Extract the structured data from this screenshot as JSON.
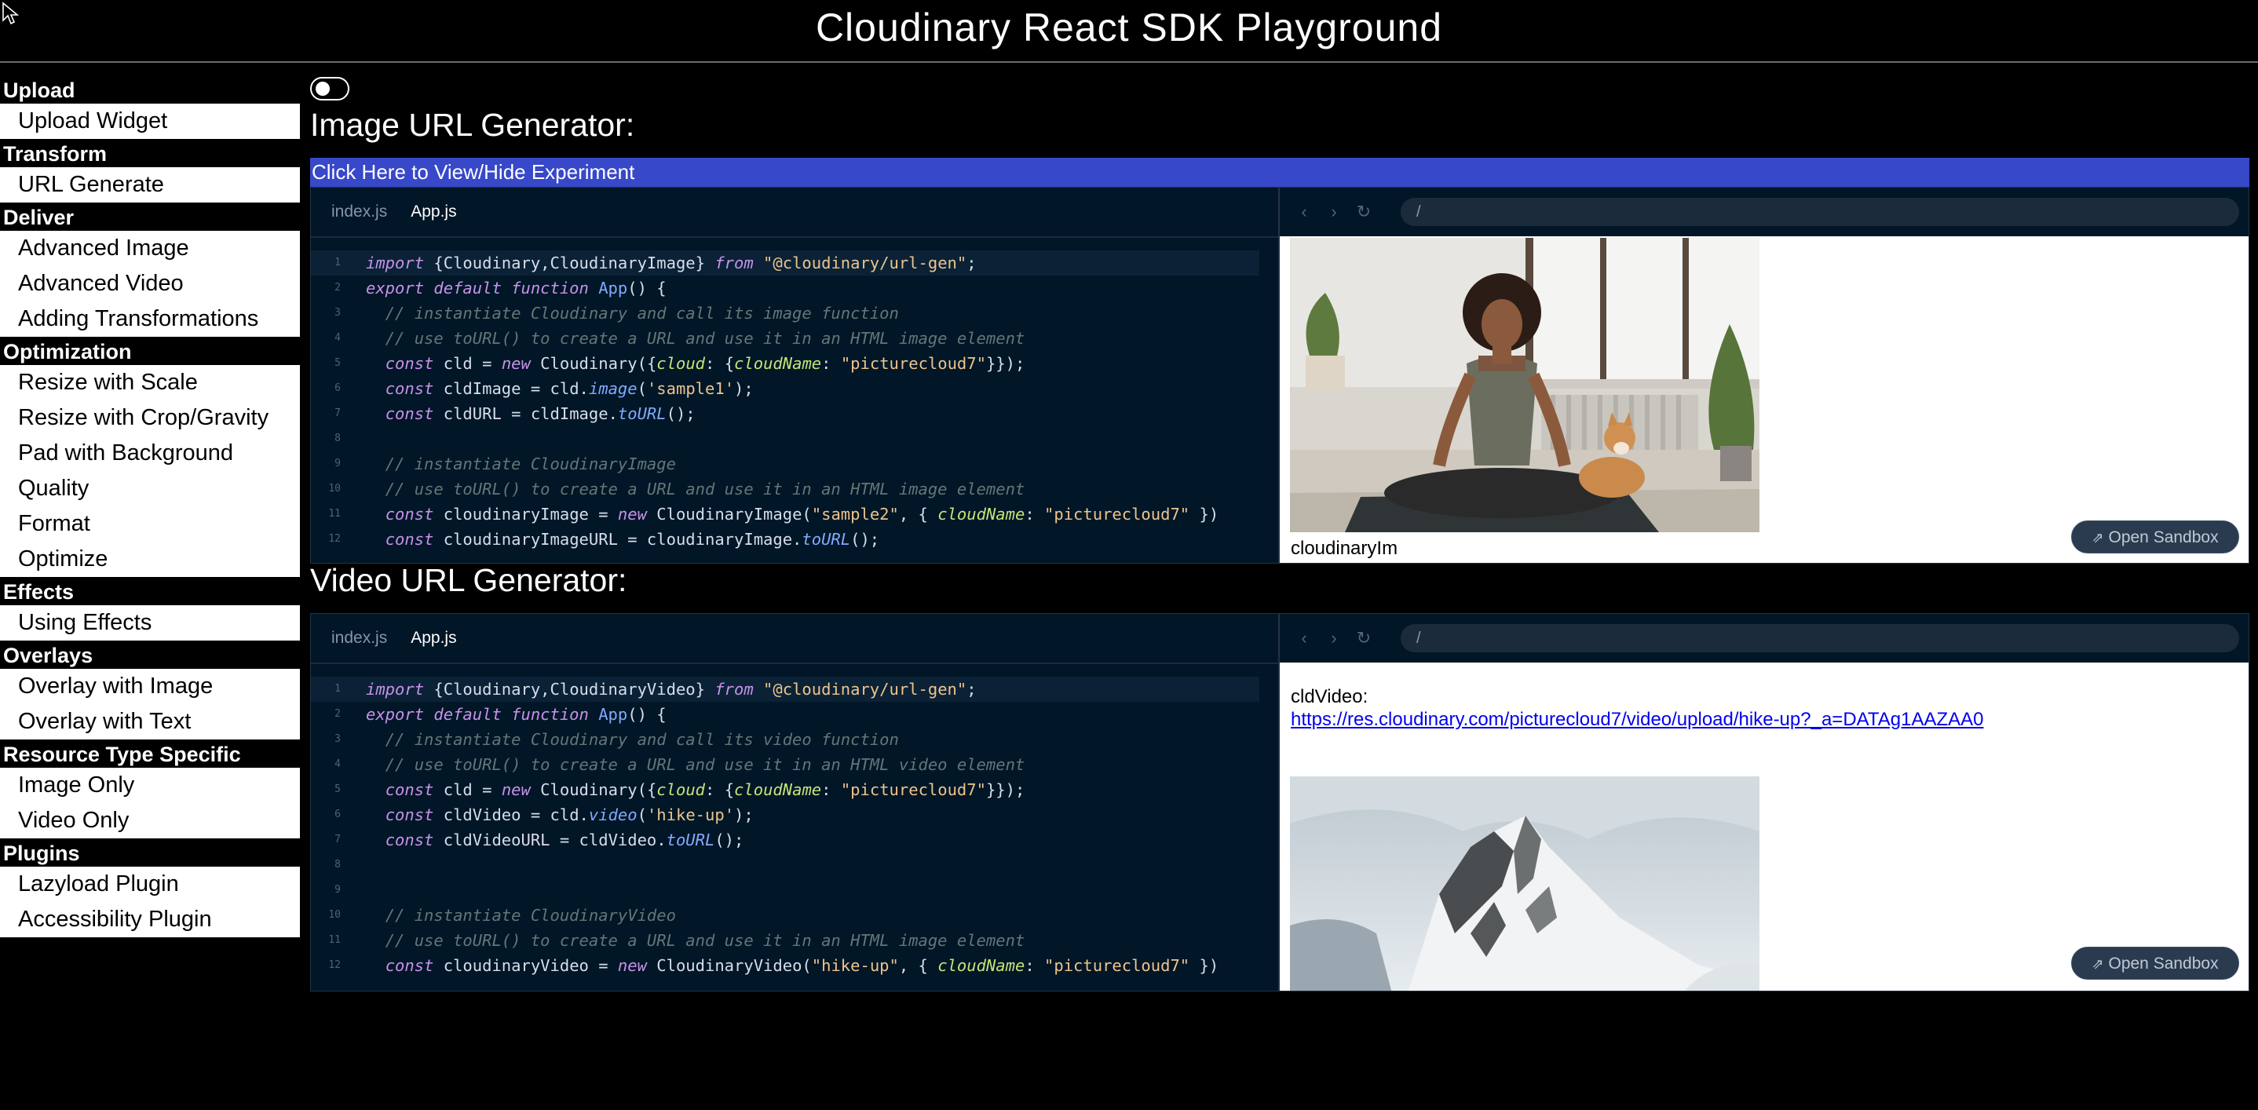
{
  "app": {
    "title": "Cloudinary React SDK Playground"
  },
  "sidebar": {
    "sections": [
      {
        "label": "Upload",
        "items": [
          "Upload Widget"
        ]
      },
      {
        "label": "Transform",
        "items": [
          "URL Generate"
        ]
      },
      {
        "label": "Deliver",
        "items": [
          "Advanced Image",
          "Advanced Video",
          "Adding Transformations"
        ]
      },
      {
        "label": "Optimization",
        "items": [
          "Resize with Scale",
          "Resize with Crop/Gravity",
          "Pad with Background",
          "Quality",
          "Format",
          "Optimize"
        ]
      },
      {
        "label": "Effects",
        "items": [
          "Using Effects"
        ]
      },
      {
        "label": "Overlays",
        "items": [
          "Overlay with Image",
          "Overlay with Text"
        ]
      },
      {
        "label": "Resource Type Specific",
        "items": [
          "Image Only",
          "Video Only"
        ]
      },
      {
        "label": "Plugins",
        "items": [
          "Lazyload Plugin",
          "Accessibility Plugin"
        ]
      }
    ]
  },
  "main": {
    "toggle_state": "off",
    "image_section": {
      "heading": "Image URL Generator:",
      "toggle_label": "Click Here to View/Hide Experiment",
      "tabs": [
        "index.js",
        "App.js"
      ],
      "active_tab": "App.js",
      "url": "/",
      "open_sandbox": "Open Sandbox",
      "line_numbers": [
        "1",
        "2",
        "3",
        "4",
        "5",
        "6",
        "7",
        "8",
        "9",
        "10",
        "11",
        "12"
      ],
      "preview_caption_partial": "cloudinaryIm"
    },
    "video_section": {
      "heading": "Video URL Generator:",
      "tabs": [
        "index.js",
        "App.js"
      ],
      "active_tab": "App.js",
      "url": "/",
      "open_sandbox": "Open Sandbox",
      "line_numbers": [
        "1",
        "2",
        "3",
        "4",
        "5",
        "6",
        "7",
        "8",
        "9",
        "10",
        "11",
        "12"
      ],
      "preview_label": "cldVideo:",
      "preview_link": "https://res.cloudinary.com/picturecloud7/video/upload/hike-up?_a=DATAg1AAZAA0"
    }
  },
  "icons": {
    "back": "chevron-left-icon",
    "forward": "chevron-right-icon",
    "refresh": "refresh-icon",
    "external": "external-link-icon"
  },
  "colors": {
    "background": "#000000",
    "experiment_bar": "#3748c9",
    "editor_bg": "#011627",
    "link": "#0000ee"
  }
}
